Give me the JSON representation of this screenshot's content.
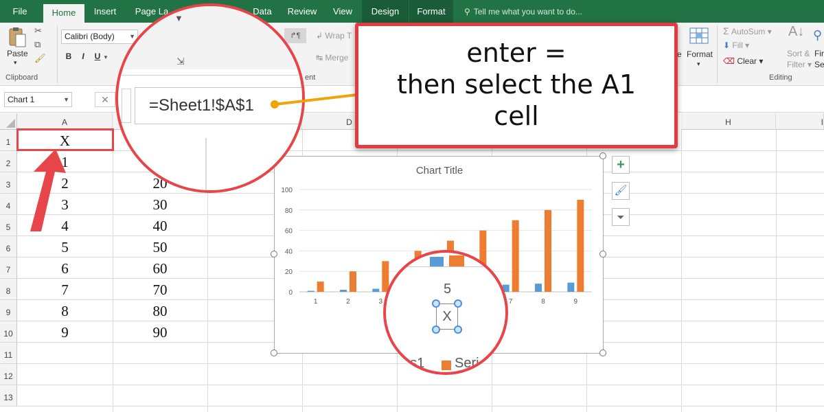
{
  "tabs": [
    {
      "label": "File",
      "state": "normal"
    },
    {
      "label": "Home",
      "state": "active"
    },
    {
      "label": "Insert",
      "state": "normal"
    },
    {
      "label": "Page La",
      "state": "normal"
    },
    {
      "label": "Data",
      "state": "normal"
    },
    {
      "label": "Review",
      "state": "normal"
    },
    {
      "label": "View",
      "state": "normal"
    },
    {
      "label": "Design",
      "state": "contextual"
    },
    {
      "label": "Format",
      "state": "contextual"
    }
  ],
  "tell_me": "Tell me what you want to do...",
  "ribbon": {
    "paste": "Paste",
    "clipboard": "Clipboard",
    "font_name": "Calibri (Body)",
    "bold": "B",
    "italic": "I",
    "underline": "U",
    "wrap_text": "Wrap T",
    "merge": "Merge",
    "alignment_partial": "ent",
    "autosum": "AutoSum",
    "fill": "Fill",
    "clear": "Clear",
    "format": "Format",
    "sort_filter_1": "Sort &",
    "sort_filter_2": "Filter",
    "find_1": "Fir",
    "find_2": "Sel",
    "editing": "Editing"
  },
  "formula_bar": {
    "name_box": "Chart 1",
    "formula": "=Sheet1!$A$1"
  },
  "columns": [
    "A",
    "D",
    "H",
    "I"
  ],
  "rows": [
    "1",
    "2",
    "3",
    "4",
    "5",
    "6",
    "7",
    "8",
    "9",
    "10",
    "11",
    "12",
    "13"
  ],
  "column_a": [
    "X",
    "1",
    "2",
    "3",
    "4",
    "5",
    "6",
    "7",
    "8",
    "9"
  ],
  "column_b": [
    "20",
    "30",
    "40",
    "50",
    "60",
    "70",
    "80",
    "90"
  ],
  "callout": {
    "line1": "enter =",
    "line2": "then select the A1",
    "line3": "cell"
  },
  "chart": {
    "title": "Chart Title",
    "zoom_label": "5",
    "selected_title": "X",
    "legend_partial_1": "es1",
    "legend_partial_2": "Seri"
  },
  "chart_data": {
    "type": "bar",
    "title": "Chart Title",
    "categories": [
      "1",
      "2",
      "3",
      "4",
      "5",
      "6",
      "7",
      "8",
      "9"
    ],
    "series": [
      {
        "values": [
          1,
          2,
          3,
          4,
          5,
          6,
          7,
          8,
          9
        ],
        "color": "#5b9bd5"
      },
      {
        "values": [
          10,
          20,
          30,
          40,
          50,
          60,
          70,
          80,
          90
        ],
        "color": "#ed7d31"
      }
    ],
    "ylim": [
      0,
      100
    ],
    "yticks": [
      0,
      20,
      40,
      60,
      80,
      100
    ],
    "legend_position": "bottom"
  },
  "colors": {
    "excel_green": "#217346",
    "annotation_red": "#e8454a",
    "leader_orange": "#f0a30a"
  }
}
